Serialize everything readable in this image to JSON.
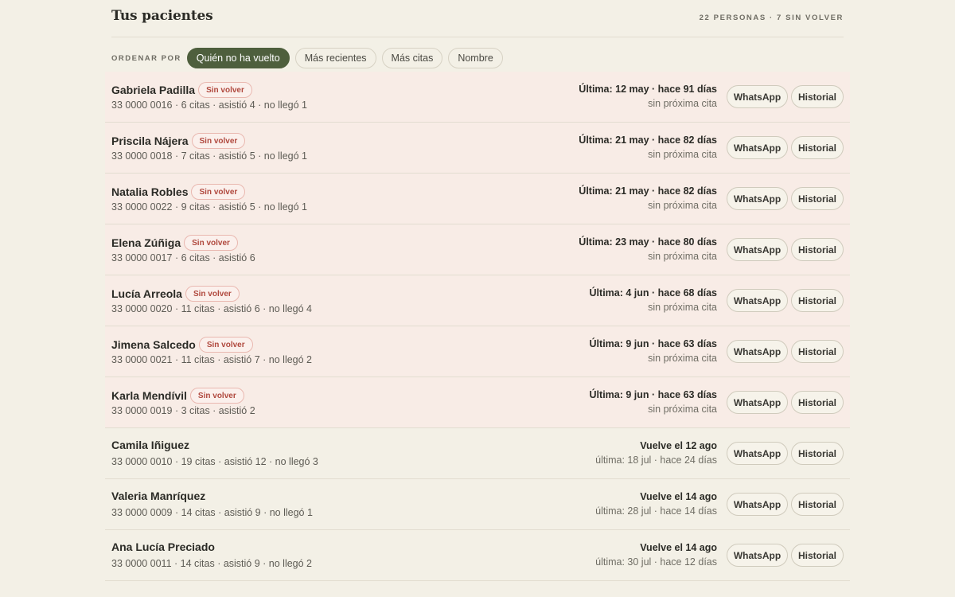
{
  "header": {
    "title": "Tus pacientes",
    "summary": "22 PERSONAS · 7 SIN VOLVER"
  },
  "sort": {
    "label": "ORDENAR POR",
    "options": [
      "Quién no ha vuelto",
      "Más recientes",
      "Más citas",
      "Nombre"
    ],
    "active_index": 0
  },
  "actions": {
    "whatsapp": "WhatsApp",
    "history": "Historial"
  },
  "badge_label": "Sin volver",
  "colors": {
    "accent": "#4e5f3d",
    "overdue_row": "#f8ece6",
    "badge_text": "#b0493e",
    "background": "#f3f0e6"
  },
  "patients": [
    {
      "name": "Gabriela Padilla",
      "overdue": true,
      "meta": "33 0000 0016 · 6 citas · asistió 4 · no llegó 1",
      "when": "Última: 12 may · hace 91 días",
      "next": "sin próxima cita"
    },
    {
      "name": "Priscila Nájera",
      "overdue": true,
      "meta": "33 0000 0018 · 7 citas · asistió 5 · no llegó 1",
      "when": "Última: 21 may · hace 82 días",
      "next": "sin próxima cita"
    },
    {
      "name": "Natalia Robles",
      "overdue": true,
      "meta": "33 0000 0022 · 9 citas · asistió 5 · no llegó 1",
      "when": "Última: 21 may · hace 82 días",
      "next": "sin próxima cita"
    },
    {
      "name": "Elena Zúñiga",
      "overdue": true,
      "meta": "33 0000 0017 · 6 citas · asistió 6",
      "when": "Última: 23 may · hace 80 días",
      "next": "sin próxima cita"
    },
    {
      "name": "Lucía Arreola",
      "overdue": true,
      "meta": "33 0000 0020 · 11 citas · asistió 6 · no llegó 4",
      "when": "Última: 4 jun · hace 68 días",
      "next": "sin próxima cita"
    },
    {
      "name": "Jimena Salcedo",
      "overdue": true,
      "meta": "33 0000 0021 · 11 citas · asistió 7 · no llegó 2",
      "when": "Última: 9 jun · hace 63 días",
      "next": "sin próxima cita"
    },
    {
      "name": "Karla Mendívil",
      "overdue": true,
      "meta": "33 0000 0019 · 3 citas · asistió 2",
      "when": "Última: 9 jun · hace 63 días",
      "next": "sin próxima cita"
    },
    {
      "name": "Camila Iñiguez",
      "overdue": false,
      "meta": "33 0000 0010 · 19 citas · asistió 12 · no llegó 3",
      "when": "Vuelve el 12 ago",
      "next": "última: 18 jul · hace 24 días"
    },
    {
      "name": "Valeria Manríquez",
      "overdue": false,
      "meta": "33 0000 0009 · 14 citas · asistió 9 · no llegó 1",
      "when": "Vuelve el 14 ago",
      "next": "última: 28 jul · hace 14 días"
    },
    {
      "name": "Ana Lucía Preciado",
      "overdue": false,
      "meta": "33 0000 0011 · 14 citas · asistió 9 · no llegó 2",
      "when": "Vuelve el 14 ago",
      "next": "última: 30 jul · hace 12 días"
    }
  ]
}
